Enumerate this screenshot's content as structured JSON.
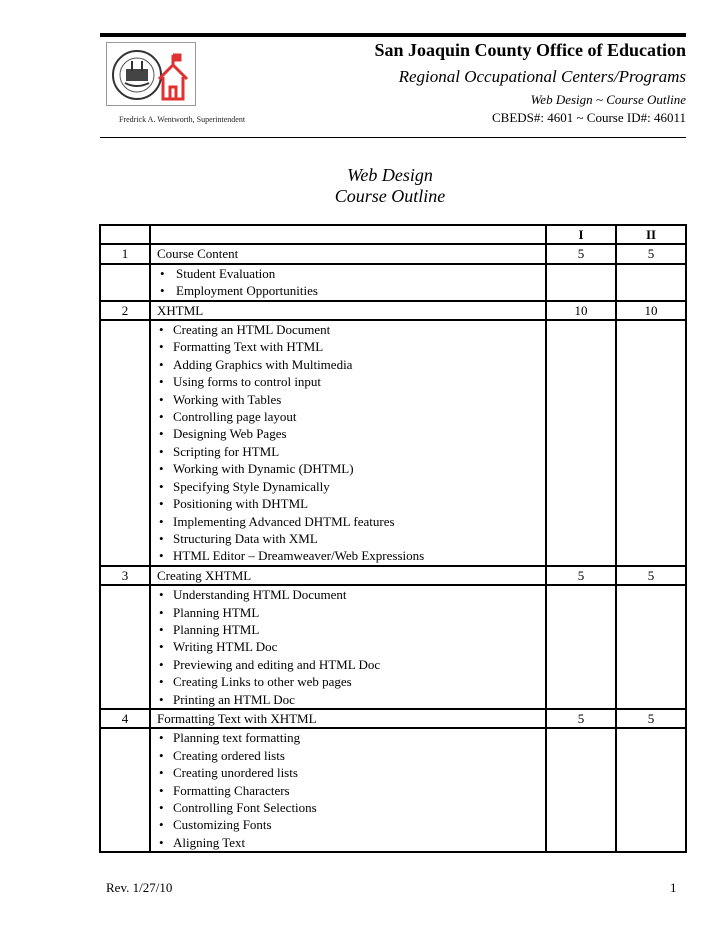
{
  "header": {
    "organization": "San Joaquin County Office of Education",
    "program": "Regional Occupational Centers/Programs",
    "course_line": "Web Design ~ Course Outline",
    "codes": "CBEDS#: 4601 ~ Course ID#: 46011",
    "superintendent": "Fredrick A. Wentworth, Superintendent",
    "logo_icons": [
      "county-seal-icon",
      "schoolhouse-icon"
    ],
    "logo_accent": "#e03030"
  },
  "title": {
    "line1": "Web Design",
    "line2": "Course Outline"
  },
  "table": {
    "columns": [
      "",
      "",
      "I",
      "II"
    ],
    "units": [
      {
        "number": "1",
        "title": "Course Content",
        "hours_1": "5",
        "hours_2": "5",
        "topics": [
          "Student Evaluation",
          "Employment Opportunities"
        ]
      },
      {
        "number": "2",
        "title": "XHTML",
        "hours_1": "10",
        "hours_2": "10",
        "topics": [
          "Creating an HTML Document",
          "Formatting Text with HTML",
          "Adding Graphics with Multimedia",
          "Using forms to control input",
          "Working with Tables",
          "Controlling page layout",
          "Designing Web Pages",
          "Scripting for HTML",
          "Working with Dynamic (DHTML)",
          "Specifying Style Dynamically",
          "Positioning with DHTML",
          "Implementing Advanced DHTML features",
          "Structuring Data with XML",
          "HTML Editor – Dreamweaver/Web Expressions"
        ]
      },
      {
        "number": "3",
        "title": "Creating XHTML",
        "hours_1": "5",
        "hours_2": "5",
        "topics": [
          "Understanding HTML Document",
          "Planning HTML",
          "Planning HTML",
          "Writing HTML Doc",
          "Previewing and editing and HTML Doc",
          "Creating Links to other web pages",
          "Printing an HTML Doc"
        ]
      },
      {
        "number": "4",
        "title": "Formatting Text with XHTML",
        "hours_1": "5",
        "hours_2": "5",
        "topics": [
          "Planning text formatting",
          "Creating ordered lists",
          "Creating unordered lists",
          "Formatting Characters",
          "Controlling Font Selections",
          "Customizing Fonts",
          "Aligning Text"
        ]
      }
    ]
  },
  "footer": {
    "revision": "Rev. 1/27/10",
    "page_number": "1"
  }
}
